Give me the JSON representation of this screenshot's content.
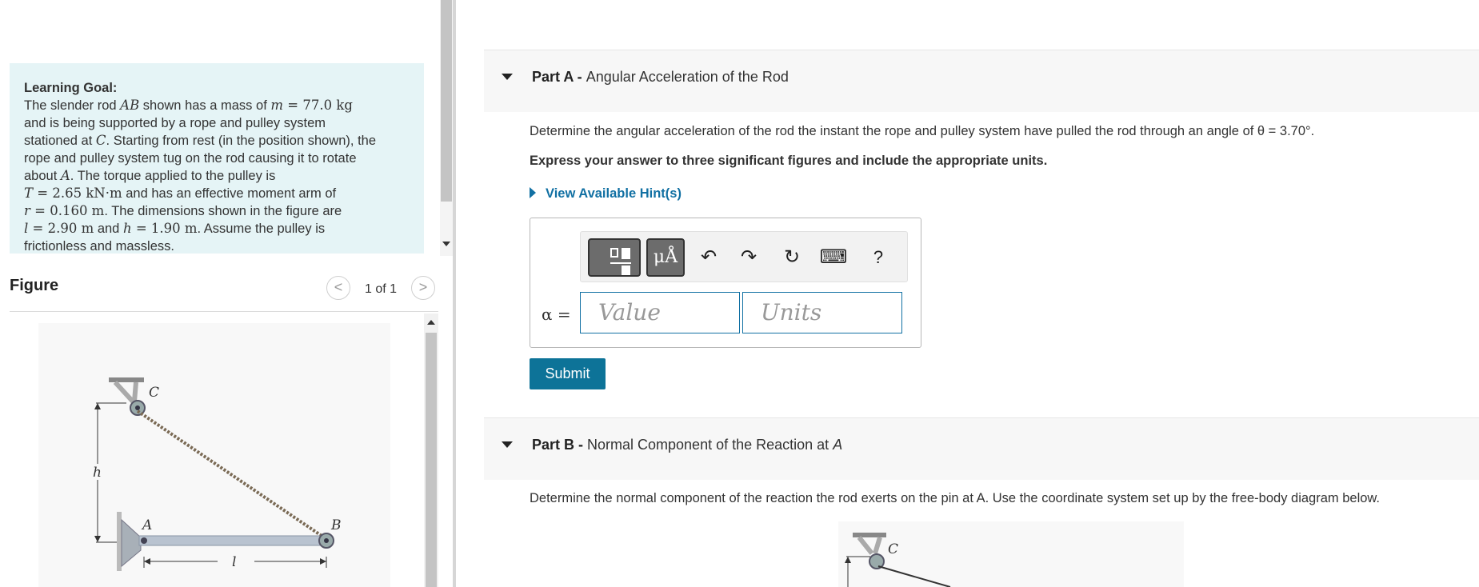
{
  "learning_goal": {
    "title": "Learning Goal:",
    "lines": [
      [
        "The slender rod ",
        "AB",
        " shown has a mass of ",
        "m",
        " = 77.0 kg"
      ],
      [
        "and is being supported by a rope and pulley system"
      ],
      [
        "stationed at ",
        "C",
        ". Starting from rest (in the position shown), the"
      ],
      [
        "rope and pulley system tug on the rod causing it to rotate"
      ],
      [
        "about ",
        "A",
        ". The torque applied to the pulley is"
      ],
      [
        "T",
        " = 2.65 kN·m",
        " and has an effective moment arm of"
      ],
      [
        "r",
        " = 0.160 m",
        ". The dimensions shown in the figure are"
      ],
      [
        "l",
        " = 2.90 m",
        " and ",
        "h",
        " = 1.90 m",
        ". Assume the pulley is"
      ],
      [
        "frictionless and massless."
      ]
    ]
  },
  "figure": {
    "title": "Figure",
    "counter": "1 of 1",
    "prev_glyph": "<",
    "next_glyph": ">",
    "labels": {
      "c": "C",
      "h": "h",
      "a": "A",
      "b": "B",
      "l": "l"
    }
  },
  "partA": {
    "label_bold": "Part A - ",
    "label_rest": "Angular Acceleration of the Rod",
    "question": "Determine the angular acceleration of the rod the instant the rope and pulley system have pulled the rod through an angle of θ = 3.70°.",
    "instructions": "Express your answer to three significant figures and include the appropriate units.",
    "hints": "View Available Hint(s)",
    "toolbar": {
      "symbols": "μÅ",
      "undo": "↶",
      "redo": "↷",
      "reset": "↻",
      "keyboard": "⌨",
      "help": "?"
    },
    "answer_label": "α =",
    "value_placeholder": "Value",
    "units_placeholder": "Units",
    "submit": "Submit"
  },
  "partB": {
    "label_bold": "Part B - ",
    "label_rest": "Normal Component of the Reaction at ",
    "label_var": "A",
    "question": "Determine the normal component of the reaction the rod exerts on the pin at A. Use the coordinate system set up by the free-body diagram below.",
    "fbd_label_c": "C"
  }
}
